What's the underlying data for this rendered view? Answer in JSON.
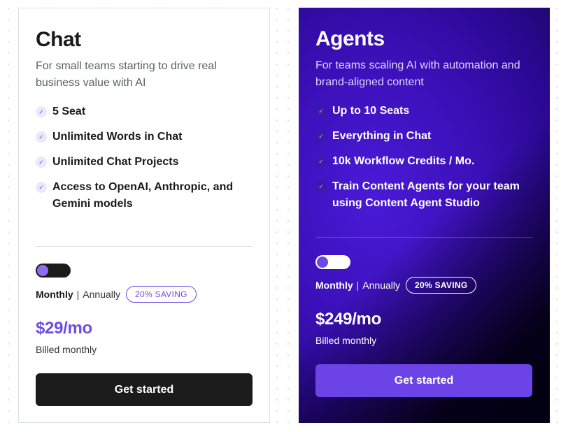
{
  "plans": {
    "chat": {
      "title": "Chat",
      "description": "For small teams starting to drive real business value with AI",
      "features": [
        "5 Seat",
        "Unlimited Words in Chat",
        "Unlimited Chat Projects",
        "Access to OpenAI, Anthropic, and Gemini models"
      ],
      "billing_toggle": {
        "state": "monthly"
      },
      "billing_monthly": "Monthly",
      "billing_separator": "|",
      "billing_annually": "Annually",
      "saving_badge": "20% SAVING",
      "price": "$29/mo",
      "billed_note": "Billed monthly",
      "cta_label": "Get started",
      "accent_color": "#6b4de6"
    },
    "agents": {
      "title": "Agents",
      "description": "For teams scaling AI with automation and brand-aligned content",
      "features": [
        "Up to 10 Seats",
        "Everything in Chat",
        "10k Workflow Credits / Mo.",
        "Train Content Agents for your team using Content Agent Studio"
      ],
      "billing_toggle": {
        "state": "monthly"
      },
      "billing_monthly": "Monthly",
      "billing_separator": "|",
      "billing_annually": "Annually",
      "saving_badge": "20% SAVING",
      "price": "$249/mo",
      "billed_note": "Billed monthly",
      "cta_label": "Get started",
      "accent_color": "#6b43e6"
    }
  },
  "icons": {
    "feature_check": "check-icon"
  }
}
